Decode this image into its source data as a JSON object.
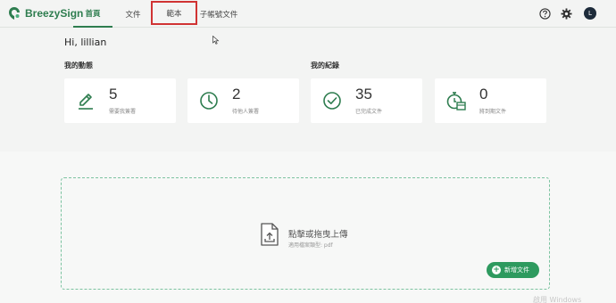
{
  "brand": {
    "name": "BreezySign",
    "color": "#2e7d4f"
  },
  "nav": {
    "tabs": [
      {
        "label": "首頁",
        "active": true
      },
      {
        "label": "文件",
        "active": false
      },
      {
        "label": "範本",
        "active": false,
        "highlighted": true
      },
      {
        "label": "子帳號文件",
        "active": false
      }
    ]
  },
  "header_icons": [
    "help-icon",
    "gear-icon"
  ],
  "user": {
    "initial": "L"
  },
  "greeting": "Hi, lillian",
  "sections": {
    "activity_title": "我的動態",
    "records_title": "我的紀錄"
  },
  "cards": [
    {
      "icon": "pen-icon",
      "value": "5",
      "label": "需要我簽署"
    },
    {
      "icon": "clock-icon",
      "value": "2",
      "label": "待他人簽署"
    },
    {
      "icon": "check-circle-icon",
      "value": "35",
      "label": "已完成文件"
    },
    {
      "icon": "timer-calendar-icon",
      "value": "0",
      "label": "將到期文件"
    }
  ],
  "upload": {
    "title": "點擊或拖曳上傳",
    "hint": "適用檔案類型: pdf",
    "new_button": "新增文件"
  },
  "watermark": "啟用 Windows"
}
